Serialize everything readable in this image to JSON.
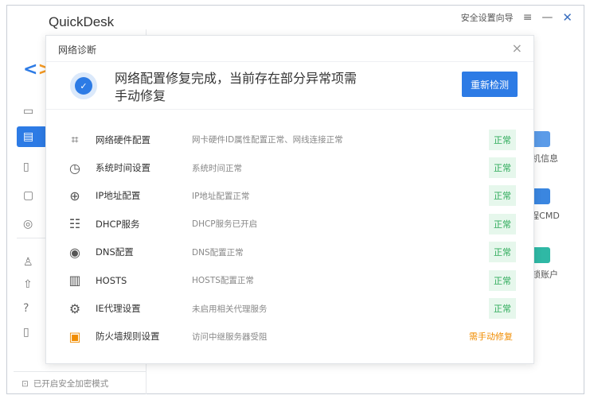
{
  "app": {
    "title": "QuickDesk",
    "security_wizard": "安全设置向导",
    "menu_icon": "≡",
    "minimize_icon": "—",
    "close_icon": "✕"
  },
  "colors": {
    "accent": "#2d7be5",
    "ok": "#2eab5a",
    "ok_bg": "#e6f7ec",
    "warn": "#f08c00"
  },
  "sidebar": {
    "footer": "已开启安全加密模式",
    "icons": [
      "monitor-icon",
      "apps-icon",
      "document-icon",
      "chat-icon",
      "settings-icon",
      "user-icon",
      "upload-icon",
      "help-icon",
      "phone-icon"
    ]
  },
  "right_panel": {
    "items": [
      "主机信息",
      "远程CMD",
      "解锁账户"
    ]
  },
  "dialog": {
    "title": "网络诊断",
    "close": "×",
    "banner_text": "网络配置修复完成，当前存在部分异常项需手动修复",
    "recheck": "重新检测",
    "rows": [
      {
        "icon": "chip-icon",
        "name": "网络硬件配置",
        "desc": "网卡硬件ID属性配置正常、网线连接正常",
        "status": "正常",
        "ok": true
      },
      {
        "icon": "clock-icon",
        "name": "系统时间设置",
        "desc": "系统时间正常",
        "status": "正常",
        "ok": true
      },
      {
        "icon": "globe-icon",
        "name": "IP地址配置",
        "desc": "IP地址配置正常",
        "status": "正常",
        "ok": true
      },
      {
        "icon": "server-icon",
        "name": "DHCP服务",
        "desc": "DHCP服务已开启",
        "status": "正常",
        "ok": true
      },
      {
        "icon": "dns-icon",
        "name": "DNS配置",
        "desc": "DNS配置正常",
        "status": "正常",
        "ok": true
      },
      {
        "icon": "hosts-icon",
        "name": "HOSTS",
        "desc": "HOSTS配置正常",
        "status": "正常",
        "ok": true
      },
      {
        "icon": "gear-icon",
        "name": "IE代理设置",
        "desc": "未启用相关代理服务",
        "status": "正常",
        "ok": true
      },
      {
        "icon": "firewall-icon",
        "name": "防火墙规则设置",
        "desc": "访问中继服务器受阻",
        "status": "需手动修复",
        "ok": false
      }
    ]
  }
}
